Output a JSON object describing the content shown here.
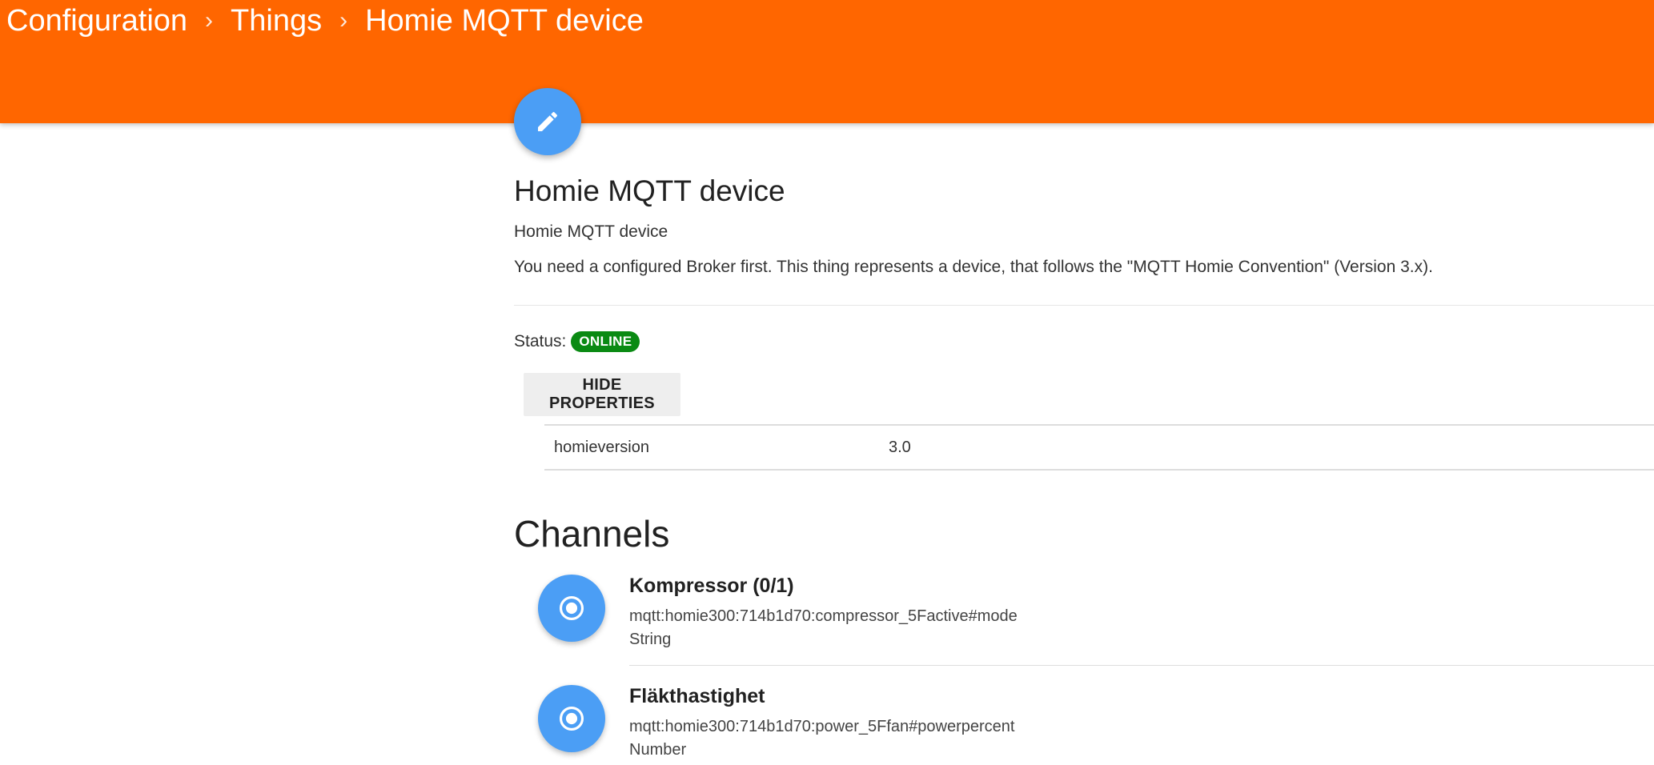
{
  "breadcrumb": [
    "Configuration",
    "Things",
    "Homie MQTT device"
  ],
  "breadcrumb_separator": "›",
  "thing": {
    "title": "Homie MQTT device",
    "subtitle": "Homie MQTT device",
    "description": "You need a configured Broker first. This thing represents a device, that follows the \"MQTT Homie Convention\" (Version 3.x).",
    "status_label": "Status:",
    "status": "ONLINE",
    "status_color": "#0a8a13"
  },
  "properties_button": "HIDE PROPERTIES",
  "properties": [
    {
      "key": "homieversion",
      "value": "3.0"
    }
  ],
  "channels_heading": "Channels",
  "channels": [
    {
      "name": "Kompressor (0/1)",
      "uid": "mqtt:homie300:714b1d70:compressor_5Factive#mode",
      "type": "String"
    },
    {
      "name": "Fläkthastighet",
      "uid": "mqtt:homie300:714b1d70:power_5Ffan#powerpercent",
      "type": "Number"
    }
  ],
  "colors": {
    "header": "#ff6600",
    "accent": "#4b9ef5"
  },
  "icons": {
    "edit": "pencil-icon",
    "channel": "radio-button-icon"
  }
}
